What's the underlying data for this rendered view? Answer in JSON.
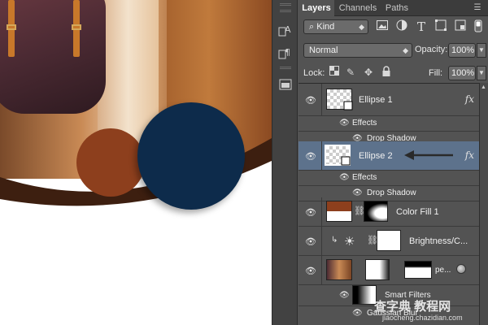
{
  "tabs": {
    "layers": "Layers",
    "channels": "Channels",
    "paths": "Paths",
    "menu_icon": "panel-menu-icon"
  },
  "filter": {
    "kind": "Kind",
    "kind_prefix": "⌕",
    "icons": [
      "image-filter-icon",
      "adjustment-filter-icon",
      "type-filter-icon",
      "shape-filter-icon",
      "smart-object-filter-icon",
      "filter-toggle-icon"
    ]
  },
  "blend": {
    "mode": "Normal",
    "opacity_label": "Opacity:",
    "opacity": "100%"
  },
  "lock": {
    "label": "Lock:",
    "fill_label": "Fill:",
    "fill": "100%",
    "icons": [
      "lock-transparent-icon",
      "lock-image-icon",
      "lock-position-icon",
      "lock-all-icon"
    ]
  },
  "layers": [
    {
      "name": "Ellipse 1",
      "fx": "fx",
      "effects_label": "Effects",
      "effect": "Drop Shadow"
    },
    {
      "name": "Ellipse 2",
      "fx": "fx",
      "effects_label": "Effects",
      "effect": "Drop Shadow",
      "selected": true
    },
    {
      "name": "Color Fill 1"
    },
    {
      "name": "Brightness/C..."
    },
    {
      "name": "pe...",
      "smart_filters": "Smart Filters",
      "filter": "Gaussian Blur"
    }
  ],
  "canvas": {
    "brown_circle_color": "#8d3f1d",
    "blue_circle_color": "#0d2b4b",
    "band_color": "#3d1f10"
  },
  "watermark": {
    "text": "查字典 教程网",
    "url": "jiaocheng.chazidian.com"
  }
}
